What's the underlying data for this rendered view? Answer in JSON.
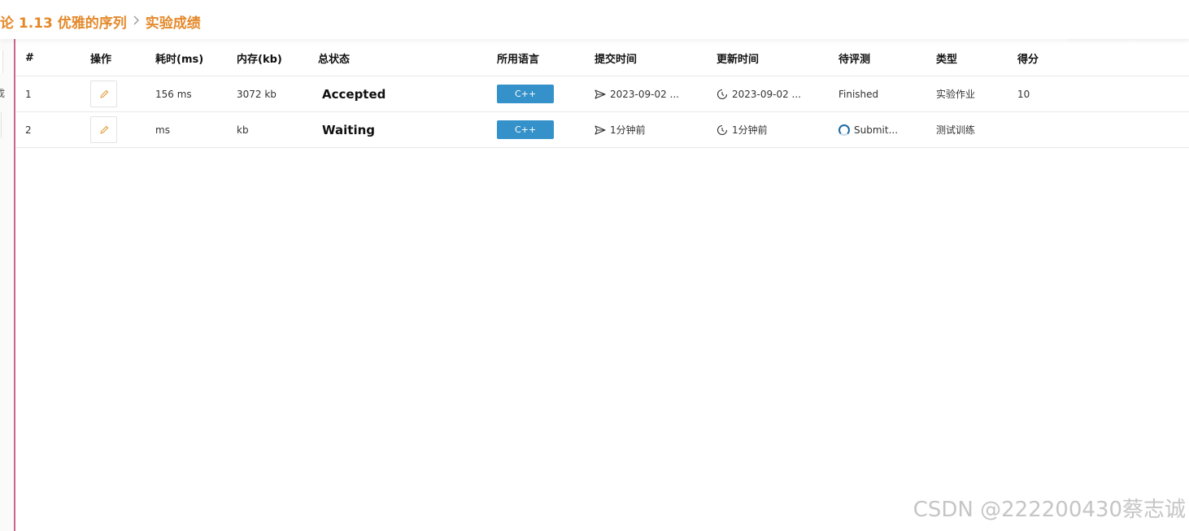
{
  "breadcrumb": {
    "part1": "论 1.13 优雅的序列",
    "part2": "实验成绩"
  },
  "sidebar": {
    "cut_char": "成"
  },
  "table": {
    "columns": [
      "#",
      "操作",
      "耗时(ms)",
      "内存(kb)",
      "总状态",
      "所用语言",
      "提交时间",
      "更新时间",
      "待评测",
      "类型",
      "得分"
    ],
    "rows": [
      {
        "id": "1",
        "time": "156 ms",
        "memory": "3072 kb",
        "status": "Accepted",
        "language": "C++",
        "submit_time": "2023-09-02 ...",
        "update_time": "2023-09-02 ...",
        "judge": "Finished",
        "type": "实验作业",
        "score": "10"
      },
      {
        "id": "2",
        "time": "ms",
        "memory": "kb",
        "status": "Waiting",
        "language": "C++",
        "submit_time": "1分钟前",
        "update_time": "1分钟前",
        "judge": "Submit...",
        "type": "测试训练",
        "score": ""
      }
    ]
  },
  "watermark": "CSDN @222200430蔡志诚",
  "colors": {
    "accent": "#e4892b",
    "lang_tag": "#3591c9",
    "side_line": "#c9668d",
    "edit_icon": "#e0a040"
  }
}
